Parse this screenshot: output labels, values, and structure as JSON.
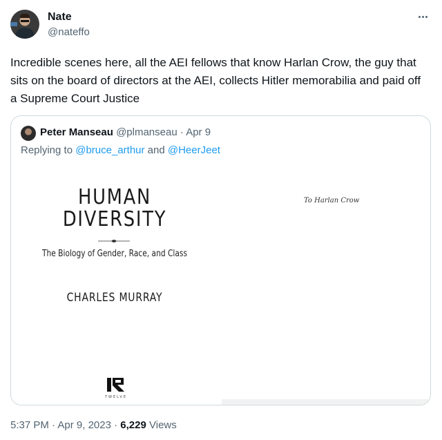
{
  "tweet": {
    "author_name": "Nate",
    "author_handle": "@nateffo",
    "text": "Incredible scenes here, all the AEI fellows that know Harlan Crow, the guy that sits on the board of directors at the AEI, collects Hitler memorabilia and paid off a Supreme Court Justice",
    "more_icon": "more-horizontal-icon",
    "time": "5:37 PM",
    "sep1": " · ",
    "date": "Apr 9, 2023",
    "sep2": " · ",
    "views_count": "6,229",
    "views_label": " Views"
  },
  "quote": {
    "author_name": "Peter Manseau",
    "author_handle": "@plmanseau",
    "sep": " · ",
    "date": "Apr 9",
    "reply_prefix": "Replying to ",
    "reply_user1": "@bruce_arthur",
    "reply_and": " and ",
    "reply_user2": "@HeerJeet"
  },
  "book": {
    "title_line1": "HUMAN",
    "title_line2": "DIVERSITY",
    "subtitle": "The Biology of Gender, Race, and Class",
    "author": "CHARLES MURRAY",
    "publisher": "TWELVE",
    "dedication": "To Harlan Crow"
  },
  "colors": {
    "text_primary": "#0f1419",
    "text_secondary": "#536471",
    "link": "#1d9bf0",
    "border": "#cfd9de"
  }
}
